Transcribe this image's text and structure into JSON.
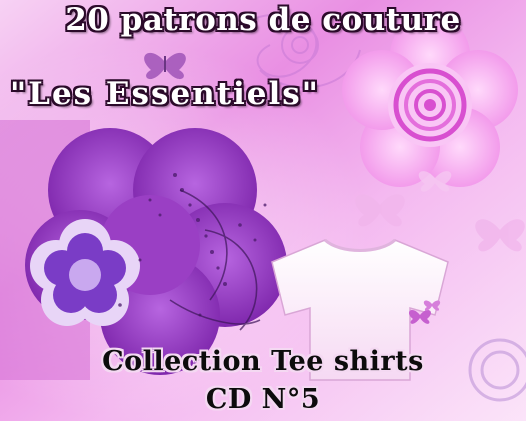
{
  "cover": {
    "title": "20 patrons de couture",
    "subtitle": "\"Les Essentiels\"",
    "collection": "Collection Tee shirts",
    "cd_number": "CD N°5"
  },
  "colors": {
    "background_light": "#f6c8f2",
    "background_mid": "#e58be0",
    "flower_purple": "#8e34b8",
    "flower_violet": "#6a2aa6",
    "flower_pink": "#f3a8ee",
    "tshirt": "#fdf2fb",
    "title_fill": "#ffffff",
    "title_outline": "#2b0a2a"
  },
  "icons": {
    "butterfly": "butterfly-icon",
    "flower": "flower-icon",
    "tshirt": "tshirt-icon",
    "swirl": "swirl-icon"
  }
}
